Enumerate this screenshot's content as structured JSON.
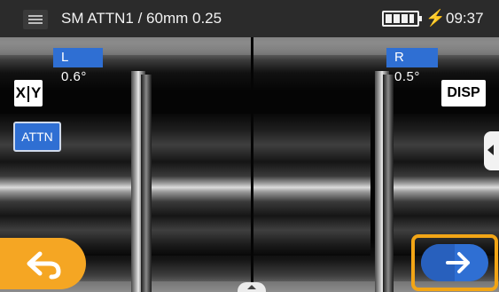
{
  "status_bar": {
    "title": "SM ATTN1 / 60mm 0.25",
    "clock": "09:37",
    "charging_icon": "⚡"
  },
  "view": {
    "left_angle": "L  0.6°",
    "right_angle": "R  0.5°"
  },
  "buttons": {
    "xy_left": "X",
    "xy_right": "Y",
    "attn": "ATTN",
    "disp": "DISP",
    "back_icon": "back-arrow-icon",
    "next_icon": "right-arrow-icon"
  },
  "colors": {
    "accent_blue": "#2f6fd3",
    "accent_orange": "#f5a623",
    "highlight_frame": "#f2a516"
  }
}
